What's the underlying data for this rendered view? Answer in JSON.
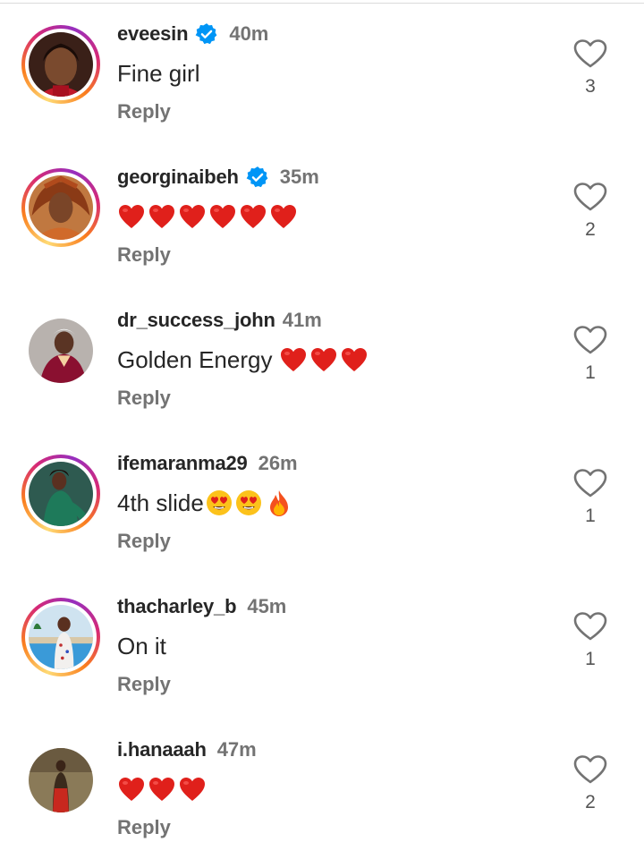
{
  "comments": [
    {
      "username": "eveesin",
      "verified": true,
      "time": "40m",
      "text": "Fine girl",
      "emojis": [],
      "reply_label": "Reply",
      "likes": "3",
      "story_ring": true
    },
    {
      "username": "georginaibeh",
      "verified": true,
      "time": "35m",
      "text": "",
      "emojis": [
        "red-heart",
        "red-heart",
        "red-heart",
        "red-heart",
        "red-heart",
        "red-heart"
      ],
      "reply_label": "Reply",
      "likes": "2",
      "story_ring": true
    },
    {
      "username": "dr_success_john",
      "verified": false,
      "time": "41m",
      "text": "Golden Energy",
      "emojis": [
        "red-heart",
        "red-heart",
        "red-heart"
      ],
      "reply_label": "Reply",
      "likes": "1",
      "story_ring": false
    },
    {
      "username": "ifemaranma29",
      "verified": false,
      "time": "26m",
      "text": "4th slide",
      "emojis": [
        "heart-eyes",
        "heart-eyes",
        "fire"
      ],
      "reply_label": "Reply",
      "likes": "1",
      "story_ring": true
    },
    {
      "username": "thacharley_b",
      "verified": false,
      "time": "45m",
      "text": "On it",
      "emojis": [],
      "reply_label": "Reply",
      "likes": "1",
      "story_ring": true
    },
    {
      "username": "i.hanaaah",
      "verified": false,
      "time": "47m",
      "text": "",
      "emojis": [
        "red-heart",
        "red-heart",
        "red-heart"
      ],
      "reply_label": "Reply",
      "likes": "2",
      "story_ring": false
    }
  ],
  "colors": {
    "verified_badge": "#0095f6",
    "heart_emoji": "#e0201b",
    "muted_text": "#737373",
    "primary_text": "#262626"
  }
}
